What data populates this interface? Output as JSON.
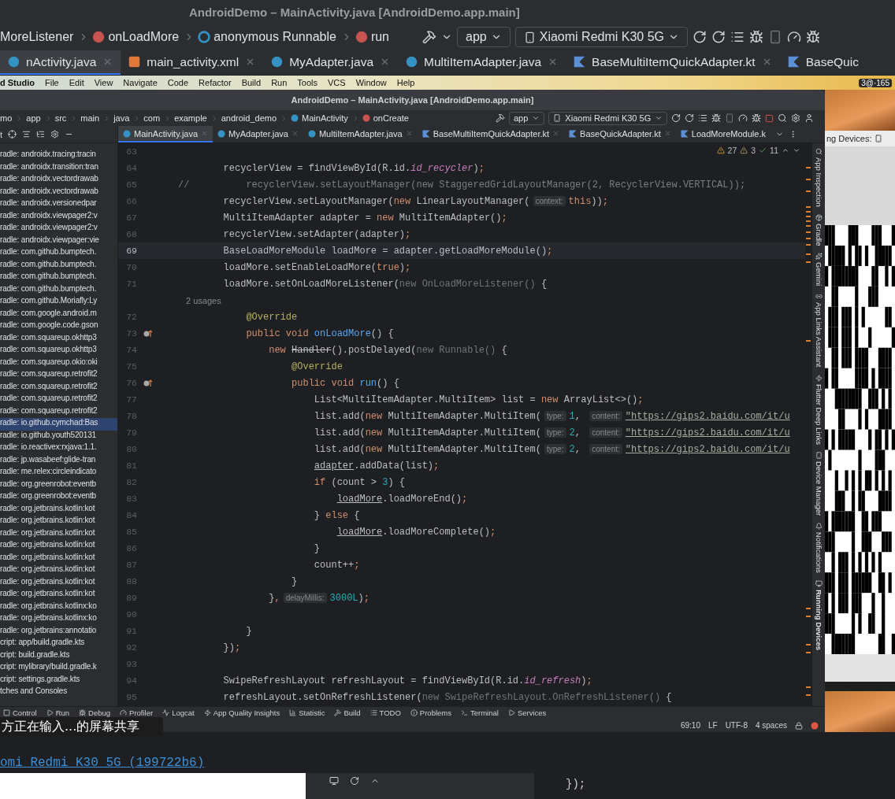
{
  "outer_window": {
    "title": "AndroidDemo – MainActivity.java [AndroidDemo.app.main]",
    "breadcrumbs": [
      {
        "label": "MoreListener",
        "kind": "plain"
      },
      {
        "label": "onLoadMore",
        "kind": "method"
      },
      {
        "label": "anonymous Runnable",
        "kind": "anonymous"
      },
      {
        "label": "run",
        "kind": "method"
      }
    ],
    "run_config": "app",
    "device": "Xiaomi Redmi K30 5G",
    "tabs": [
      {
        "label": "nActivity.java",
        "kind": "java",
        "selected": true
      },
      {
        "label": "main_activity.xml",
        "kind": "xml",
        "selected": false
      },
      {
        "label": "MyAdapter.java",
        "kind": "java",
        "selected": false
      },
      {
        "label": "MultiItemAdapter.java",
        "kind": "java",
        "selected": false
      },
      {
        "label": "BaseMultiItemQuickAdapter.kt",
        "kind": "kotlin",
        "selected": false
      },
      {
        "label": "BaseQuic",
        "kind": "kotlin",
        "selected": false
      }
    ]
  },
  "menu_bar": {
    "app_name": "d Studio",
    "items": [
      "File",
      "Edit",
      "View",
      "Navigate",
      "Code",
      "Refactor",
      "Build",
      "Run",
      "Tools",
      "VCS",
      "Window",
      "Help"
    ],
    "status": "3@·165"
  },
  "ide": {
    "title": "AndroidDemo – MainActivity.java [AndroidDemo.app.main]",
    "breadcrumbs": [
      {
        "label": "mo",
        "kind": "plain"
      },
      {
        "label": "app",
        "kind": "plain"
      },
      {
        "label": "src",
        "kind": "plain"
      },
      {
        "label": "main",
        "kind": "plain"
      },
      {
        "label": "java",
        "kind": "plain"
      },
      {
        "label": "com",
        "kind": "plain"
      },
      {
        "label": "example",
        "kind": "plain"
      },
      {
        "label": "android_demo",
        "kind": "plain"
      },
      {
        "label": "MainActivity",
        "kind": "class"
      },
      {
        "label": "onCreate",
        "kind": "method"
      }
    ],
    "run_config": "app",
    "device": "Xiaomi Redmi K30 5G",
    "project_panel": {
      "header": "t",
      "items": [
        {
          "label": "radle: androidx.tracing:tracin",
          "selected": false
        },
        {
          "label": "radle: androidx.transition:tran",
          "selected": false
        },
        {
          "label": "radle: androidx.vectordrawab",
          "selected": false
        },
        {
          "label": "radle: androidx.vectordrawab",
          "selected": false
        },
        {
          "label": "radle: androidx.versionedpar",
          "selected": false
        },
        {
          "label": "radle: androidx.viewpager2:v",
          "selected": false
        },
        {
          "label": "radle: androidx.viewpager2:v",
          "selected": false
        },
        {
          "label": "radle: androidx.viewpager:vie",
          "selected": false
        },
        {
          "label": "radle: com.github.bumptech.",
          "selected": false
        },
        {
          "label": "radle: com.github.bumptech.",
          "selected": false
        },
        {
          "label": "radle: com.github.bumptech.",
          "selected": false
        },
        {
          "label": "radle: com.github.bumptech.",
          "selected": false
        },
        {
          "label": "radle: com.github.Moriafly:Ly",
          "selected": false
        },
        {
          "label": "radle: com.google.android.m",
          "selected": false
        },
        {
          "label": "radle: com.google.code.gson",
          "selected": false
        },
        {
          "label": "radle: com.squareup.okhttp3",
          "selected": false
        },
        {
          "label": "radle: com.squareup.okhttp3",
          "selected": false
        },
        {
          "label": "radle: com.squareup.okio:oki",
          "selected": false
        },
        {
          "label": "radle: com.squareup.retrofit2",
          "selected": false
        },
        {
          "label": "radle: com.squareup.retrofit2",
          "selected": false
        },
        {
          "label": "radle: com.squareup.retrofit2",
          "selected": false
        },
        {
          "label": "radle: com.squareup.retrofit2",
          "selected": false
        },
        {
          "label": "radle: io.github.cymchad:Bas",
          "selected": true
        },
        {
          "label": "radle: io.github.youth520131",
          "selected": false
        },
        {
          "label": "radle: io.reactivex:rxjava:1.1.",
          "selected": false
        },
        {
          "label": "radle: jp.wasabeef:glide-tran",
          "selected": false
        },
        {
          "label": "radle: me.relex:circleindicato",
          "selected": false
        },
        {
          "label": "radle: org.greenrobot:eventb",
          "selected": false
        },
        {
          "label": "radle: org.greenrobot:eventb",
          "selected": false
        },
        {
          "label": "radle: org.jetbrains.kotlin:kot",
          "selected": false
        },
        {
          "label": "radle: org.jetbrains.kotlin:kot",
          "selected": false
        },
        {
          "label": "radle: org.jetbrains.kotlin:kot",
          "selected": false
        },
        {
          "label": "radle: org.jetbrains.kotlin:kot",
          "selected": false
        },
        {
          "label": "radle: org.jetbrains.kotlin:kot",
          "selected": false
        },
        {
          "label": "radle: org.jetbrains.kotlin:kot",
          "selected": false
        },
        {
          "label": "radle: org.jetbrains.kotlin:kot",
          "selected": false
        },
        {
          "label": "radle: org.jetbrains.kotlin:kot",
          "selected": false
        },
        {
          "label": "radle: org.jetbrains.kotlinx:ko",
          "selected": false
        },
        {
          "label": "radle: org.jetbrains.kotlinx:ko",
          "selected": false
        },
        {
          "label": "radle: org.jetbrains:annotatio",
          "selected": false
        },
        {
          "label": "cript: app/build.gradle.kts",
          "selected": false
        },
        {
          "label": "cript: build.gradle.kts",
          "selected": false
        },
        {
          "label": "cript: mylibrary/build.gradle.k",
          "selected": false
        },
        {
          "label": "cript: settings.gradle.kts",
          "selected": false
        },
        {
          "label": "tches and Consoles",
          "selected": false
        }
      ]
    },
    "tabs": [
      {
        "label": "MainActivity.java",
        "kind": "java",
        "selected": true
      },
      {
        "label": "MyAdapter.java",
        "kind": "java",
        "selected": false
      },
      {
        "label": "MultiItemAdapter.java",
        "kind": "java",
        "selected": false
      },
      {
        "label": "BaseMultiItemQuickAdapter.kt",
        "kind": "kotlin",
        "selected": false
      },
      {
        "label": "BaseQuickAdapter.kt",
        "kind": "kotlin",
        "selected": false
      },
      {
        "label": "LoadMoreModule.k",
        "kind": "kotlin",
        "selected": false
      }
    ],
    "inspections": {
      "warnings": "27",
      "weak_warnings": "3",
      "typos": "11"
    },
    "code_lines": [
      {
        "kind": "code",
        "num": "63",
        "current": false
      },
      {
        "kind": "code",
        "num": "64",
        "current": false,
        "tokens": [
          {
            "kind": "plain",
            "t": "        recyclerView = findViewById(R.id."
          },
          {
            "kind": "field",
            "t": "id_recycler"
          },
          {
            "kind": "plain",
            "t": ")"
          },
          {
            "kind": "keyword",
            "t": ";"
          }
        ]
      },
      {
        "kind": "code",
        "num": "65",
        "current": false,
        "tokens": [
          {
            "kind": "comment",
            "t": "//          recyclerView.setLayoutManager(new StaggeredGridLayoutManager(2, RecyclerView.VERTICAL));"
          }
        ]
      },
      {
        "kind": "code",
        "num": "66",
        "current": false,
        "tokens": [
          {
            "kind": "plain",
            "t": "        recyclerView.setLayoutManager("
          },
          {
            "kind": "keyword",
            "t": "new"
          },
          {
            "kind": "plain",
            "t": " LinearLayoutManager("
          },
          {
            "kind": "hint",
            "t": "context:"
          },
          {
            "kind": "keyword",
            "t": "this"
          },
          {
            "kind": "plain",
            "t": "))"
          },
          {
            "kind": "keyword",
            "t": ";"
          }
        ]
      },
      {
        "kind": "code",
        "num": "67",
        "current": false,
        "tokens": [
          {
            "kind": "plain",
            "t": "        MultiItemAdapter adapter = "
          },
          {
            "kind": "keyword",
            "t": "new"
          },
          {
            "kind": "plain",
            "t": " MultiItemAdapter()"
          },
          {
            "kind": "keyword",
            "t": ";"
          }
        ]
      },
      {
        "kind": "code",
        "num": "68",
        "current": false,
        "tokens": [
          {
            "kind": "plain",
            "t": "        recyclerView.setAdapter(adapter)"
          },
          {
            "kind": "keyword",
            "t": ";"
          }
        ]
      },
      {
        "kind": "code",
        "num": "69",
        "current": true,
        "tokens": [
          {
            "kind": "plain",
            "t": "        BaseLoadMoreModule loadMore = adapter.getLoadMoreModule()"
          },
          {
            "kind": "keyword",
            "t": ";"
          }
        ]
      },
      {
        "kind": "code",
        "num": "70",
        "current": false,
        "tokens": [
          {
            "kind": "plain",
            "t": "        loadMore.setEnableLoadMore("
          },
          {
            "kind": "keyword",
            "t": "true"
          },
          {
            "kind": "plain",
            "t": ")"
          },
          {
            "kind": "keyword",
            "t": ";"
          }
        ]
      },
      {
        "kind": "code",
        "num": "71",
        "current": false,
        "tokens": [
          {
            "kind": "plain",
            "t": "        loadMore.setOnLoadMoreListener("
          },
          {
            "kind": "dim",
            "t": "new OnLoadMoreListener()"
          },
          {
            "kind": "plain",
            "t": " {"
          }
        ]
      },
      {
        "kind": "usages",
        "text": "2 usages"
      },
      {
        "kind": "code",
        "num": "72",
        "current": false,
        "tokens": [
          {
            "kind": "annotation",
            "t": "            @Override"
          }
        ]
      },
      {
        "kind": "code",
        "num": "73",
        "current": false,
        "overrides": true,
        "tokens": [
          {
            "kind": "keyword",
            "t": "            public void "
          },
          {
            "kind": "method",
            "t": "onLoadMore"
          },
          {
            "kind": "plain",
            "t": "() {"
          }
        ]
      },
      {
        "kind": "code",
        "num": "74",
        "current": false,
        "tokens": [
          {
            "kind": "keyword",
            "t": "                new "
          },
          {
            "kind": "deprecated",
            "t": "Handler"
          },
          {
            "kind": "plain",
            "t": "().postDelayed("
          },
          {
            "kind": "dim",
            "t": "new Runnable()"
          },
          {
            "kind": "plain",
            "t": " {"
          }
        ]
      },
      {
        "kind": "code",
        "num": "75",
        "current": false,
        "tokens": [
          {
            "kind": "annotation",
            "t": "                    @Override"
          }
        ]
      },
      {
        "kind": "code",
        "num": "76",
        "current": false,
        "overrides": true,
        "tokens": [
          {
            "kind": "keyword",
            "t": "                    public void "
          },
          {
            "kind": "method",
            "t": "run"
          },
          {
            "kind": "plain",
            "t": "() {"
          }
        ]
      },
      {
        "kind": "code",
        "num": "77",
        "current": false,
        "tokens": [
          {
            "kind": "plain",
            "t": "                        List<MultiItemAdapter.MultiItem> list = "
          },
          {
            "kind": "keyword",
            "t": "new"
          },
          {
            "kind": "plain",
            "t": " ArrayList<>()"
          },
          {
            "kind": "keyword",
            "t": ";"
          }
        ]
      },
      {
        "kind": "code",
        "num": "78",
        "current": false,
        "tokens": [
          {
            "kind": "plain",
            "t": "                        list.add("
          },
          {
            "kind": "keyword",
            "t": "new"
          },
          {
            "kind": "plain",
            "t": " MultiItemAdapter.MultiItem("
          },
          {
            "kind": "hint",
            "t": "type:"
          },
          {
            "kind": "number",
            "t": "1"
          },
          {
            "kind": "plain",
            "t": ", "
          },
          {
            "kind": "hint",
            "t": "content:"
          },
          {
            "kind": "string",
            "t": "\"https://gips2.baidu.com/it/u"
          }
        ]
      },
      {
        "kind": "code",
        "num": "79",
        "current": false,
        "tokens": [
          {
            "kind": "plain",
            "t": "                        list.add("
          },
          {
            "kind": "keyword",
            "t": "new"
          },
          {
            "kind": "plain",
            "t": " MultiItemAdapter.MultiItem("
          },
          {
            "kind": "hint",
            "t": "type:"
          },
          {
            "kind": "number",
            "t": "2"
          },
          {
            "kind": "plain",
            "t": ", "
          },
          {
            "kind": "hint",
            "t": "content:"
          },
          {
            "kind": "string",
            "t": "\"https://gips2.baidu.com/it/u"
          }
        ]
      },
      {
        "kind": "code",
        "num": "80",
        "current": false,
        "tokens": [
          {
            "kind": "plain",
            "t": "                        list.add("
          },
          {
            "kind": "keyword",
            "t": "new"
          },
          {
            "kind": "plain",
            "t": " MultiItemAdapter.MultiItem("
          },
          {
            "kind": "hint",
            "t": "type:"
          },
          {
            "kind": "number",
            "t": "2"
          },
          {
            "kind": "plain",
            "t": ", "
          },
          {
            "kind": "hint",
            "t": "content:"
          },
          {
            "kind": "string",
            "t": "\"https://gips2.baidu.com/it/u"
          }
        ]
      },
      {
        "kind": "code",
        "num": "81",
        "current": false,
        "tokens": [
          {
            "kind": "underlined",
            "t": "                        adapter"
          },
          {
            "kind": "plain",
            "t": ".addData(list)"
          },
          {
            "kind": "keyword",
            "t": ";"
          }
        ]
      },
      {
        "kind": "code",
        "num": "82",
        "current": false,
        "tokens": [
          {
            "kind": "keyword",
            "t": "                        if"
          },
          {
            "kind": "plain",
            "t": " (count > "
          },
          {
            "kind": "number",
            "t": "3"
          },
          {
            "kind": "plain",
            "t": ") {"
          }
        ]
      },
      {
        "kind": "code",
        "num": "83",
        "current": false,
        "tokens": [
          {
            "kind": "underlined",
            "t": "                            loadMore"
          },
          {
            "kind": "plain",
            "t": ".loadMoreEnd()"
          },
          {
            "kind": "keyword",
            "t": ";"
          }
        ]
      },
      {
        "kind": "code",
        "num": "84",
        "current": false,
        "tokens": [
          {
            "kind": "plain",
            "t": "                        } "
          },
          {
            "kind": "keyword",
            "t": "else"
          },
          {
            "kind": "plain",
            "t": " {"
          }
        ]
      },
      {
        "kind": "code",
        "num": "85",
        "current": false,
        "tokens": [
          {
            "kind": "underlined",
            "t": "                            loadMore"
          },
          {
            "kind": "plain",
            "t": ".loadMoreComplete()"
          },
          {
            "kind": "keyword",
            "t": ";"
          }
        ]
      },
      {
        "kind": "code",
        "num": "86",
        "current": false,
        "tokens": [
          {
            "kind": "plain",
            "t": "                        }"
          }
        ]
      },
      {
        "kind": "code",
        "num": "87",
        "current": false,
        "tokens": [
          {
            "kind": "plain",
            "t": "                        count++"
          },
          {
            "kind": "keyword",
            "t": ";"
          }
        ]
      },
      {
        "kind": "code",
        "num": "88",
        "current": false,
        "tokens": [
          {
            "kind": "plain",
            "t": "                    }"
          }
        ]
      },
      {
        "kind": "code",
        "num": "89",
        "current": false,
        "tokens": [
          {
            "kind": "plain",
            "t": "                }"
          },
          {
            "kind": "keyword",
            "t": ","
          },
          {
            "kind": "hint",
            "t": "delayMillis:"
          },
          {
            "kind": "number",
            "t": "3000L"
          },
          {
            "kind": "plain",
            "t": ")"
          },
          {
            "kind": "keyword",
            "t": ";"
          }
        ]
      },
      {
        "kind": "code",
        "num": "90",
        "current": false
      },
      {
        "kind": "code",
        "num": "91",
        "current": false,
        "tokens": [
          {
            "kind": "plain",
            "t": "            }"
          }
        ]
      },
      {
        "kind": "code",
        "num": "92",
        "current": false,
        "tokens": [
          {
            "kind": "plain",
            "t": "        })"
          },
          {
            "kind": "keyword",
            "t": ";"
          }
        ]
      },
      {
        "kind": "code",
        "num": "93",
        "current": false
      },
      {
        "kind": "code",
        "num": "94",
        "current": false,
        "tokens": [
          {
            "kind": "plain",
            "t": "        SwipeRefreshLayout refreshLayout = findViewById(R.id."
          },
          {
            "kind": "field",
            "t": "id_refresh"
          },
          {
            "kind": "plain",
            "t": ")"
          },
          {
            "kind": "keyword",
            "t": ";"
          }
        ]
      },
      {
        "kind": "code",
        "num": "95",
        "current": false,
        "tokens": [
          {
            "kind": "plain",
            "t": "        refreshLayout.setOnRefreshListener("
          },
          {
            "kind": "dim",
            "t": "new SwipeRefreshLayout.OnRefreshListener()"
          },
          {
            "kind": "plain",
            "t": " {"
          }
        ]
      }
    ],
    "tool_stripe": [
      {
        "label": "App Inspection",
        "selected": false
      },
      {
        "label": "Gradle",
        "selected": false
      },
      {
        "label": "Gemini",
        "selected": false
      },
      {
        "label": "App Links Assistant",
        "selected": false
      },
      {
        "label": "Flutter Deep Links",
        "selected": false
      },
      {
        "label": "Device Manager",
        "selected": false
      },
      {
        "label": "Notifications",
        "selected": false
      },
      {
        "label": "Running Devices",
        "selected": true
      }
    ],
    "tool_bar": [
      "Control",
      "Run",
      "Debug",
      "Profiler",
      "Logcat",
      "App Quality Insights",
      "Statistic",
      "Build",
      "TODO",
      "Problems",
      "Terminal",
      "Services"
    ],
    "status_bar": [
      "69:10",
      "LF",
      "UTF-8",
      "4 spaces"
    ]
  },
  "screen_share_notice": "方正在输入...的屏幕共享",
  "running_devices": {
    "header": "ng Devices:"
  },
  "background": {
    "device_link": "omi Redmi K30 5G (199722b6)",
    "code_fragment": "});"
  }
}
